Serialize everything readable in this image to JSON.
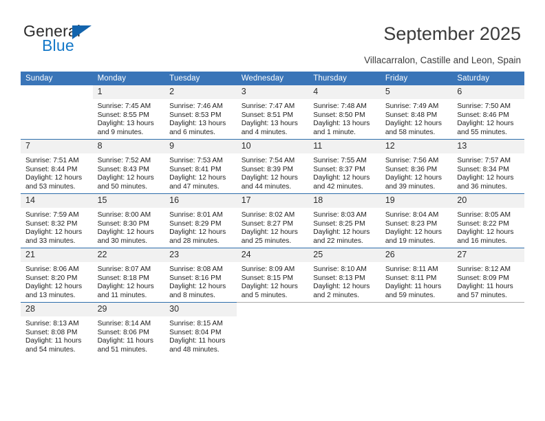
{
  "brand": {
    "name_top": "General",
    "name_bottom": "Blue",
    "triangle_color": "#1263ac",
    "text_color": "#1478c8"
  },
  "header": {
    "title": "September 2025",
    "location": "Villacarralon, Castille and Leon, Spain"
  },
  "theme": {
    "header_row_bg": "#3a75b8",
    "header_row_text": "#ffffff",
    "daynum_bg": "#f1f1f1",
    "row_divider": "#2b6cab",
    "page_bg": "#ffffff"
  },
  "weekdays": [
    "Sunday",
    "Monday",
    "Tuesday",
    "Wednesday",
    "Thursday",
    "Friday",
    "Saturday"
  ],
  "weeks": [
    [
      {
        "day": "",
        "sunrise": "",
        "sunset": "",
        "daylight1": "",
        "daylight2": ""
      },
      {
        "day": "1",
        "sunrise": "Sunrise: 7:45 AM",
        "sunset": "Sunset: 8:55 PM",
        "daylight1": "Daylight: 13 hours",
        "daylight2": "and 9 minutes."
      },
      {
        "day": "2",
        "sunrise": "Sunrise: 7:46 AM",
        "sunset": "Sunset: 8:53 PM",
        "daylight1": "Daylight: 13 hours",
        "daylight2": "and 6 minutes."
      },
      {
        "day": "3",
        "sunrise": "Sunrise: 7:47 AM",
        "sunset": "Sunset: 8:51 PM",
        "daylight1": "Daylight: 13 hours",
        "daylight2": "and 4 minutes."
      },
      {
        "day": "4",
        "sunrise": "Sunrise: 7:48 AM",
        "sunset": "Sunset: 8:50 PM",
        "daylight1": "Daylight: 13 hours",
        "daylight2": "and 1 minute."
      },
      {
        "day": "5",
        "sunrise": "Sunrise: 7:49 AM",
        "sunset": "Sunset: 8:48 PM",
        "daylight1": "Daylight: 12 hours",
        "daylight2": "and 58 minutes."
      },
      {
        "day": "6",
        "sunrise": "Sunrise: 7:50 AM",
        "sunset": "Sunset: 8:46 PM",
        "daylight1": "Daylight: 12 hours",
        "daylight2": "and 55 minutes."
      }
    ],
    [
      {
        "day": "7",
        "sunrise": "Sunrise: 7:51 AM",
        "sunset": "Sunset: 8:44 PM",
        "daylight1": "Daylight: 12 hours",
        "daylight2": "and 53 minutes."
      },
      {
        "day": "8",
        "sunrise": "Sunrise: 7:52 AM",
        "sunset": "Sunset: 8:43 PM",
        "daylight1": "Daylight: 12 hours",
        "daylight2": "and 50 minutes."
      },
      {
        "day": "9",
        "sunrise": "Sunrise: 7:53 AM",
        "sunset": "Sunset: 8:41 PM",
        "daylight1": "Daylight: 12 hours",
        "daylight2": "and 47 minutes."
      },
      {
        "day": "10",
        "sunrise": "Sunrise: 7:54 AM",
        "sunset": "Sunset: 8:39 PM",
        "daylight1": "Daylight: 12 hours",
        "daylight2": "and 44 minutes."
      },
      {
        "day": "11",
        "sunrise": "Sunrise: 7:55 AM",
        "sunset": "Sunset: 8:37 PM",
        "daylight1": "Daylight: 12 hours",
        "daylight2": "and 42 minutes."
      },
      {
        "day": "12",
        "sunrise": "Sunrise: 7:56 AM",
        "sunset": "Sunset: 8:36 PM",
        "daylight1": "Daylight: 12 hours",
        "daylight2": "and 39 minutes."
      },
      {
        "day": "13",
        "sunrise": "Sunrise: 7:57 AM",
        "sunset": "Sunset: 8:34 PM",
        "daylight1": "Daylight: 12 hours",
        "daylight2": "and 36 minutes."
      }
    ],
    [
      {
        "day": "14",
        "sunrise": "Sunrise: 7:59 AM",
        "sunset": "Sunset: 8:32 PM",
        "daylight1": "Daylight: 12 hours",
        "daylight2": "and 33 minutes."
      },
      {
        "day": "15",
        "sunrise": "Sunrise: 8:00 AM",
        "sunset": "Sunset: 8:30 PM",
        "daylight1": "Daylight: 12 hours",
        "daylight2": "and 30 minutes."
      },
      {
        "day": "16",
        "sunrise": "Sunrise: 8:01 AM",
        "sunset": "Sunset: 8:29 PM",
        "daylight1": "Daylight: 12 hours",
        "daylight2": "and 28 minutes."
      },
      {
        "day": "17",
        "sunrise": "Sunrise: 8:02 AM",
        "sunset": "Sunset: 8:27 PM",
        "daylight1": "Daylight: 12 hours",
        "daylight2": "and 25 minutes."
      },
      {
        "day": "18",
        "sunrise": "Sunrise: 8:03 AM",
        "sunset": "Sunset: 8:25 PM",
        "daylight1": "Daylight: 12 hours",
        "daylight2": "and 22 minutes."
      },
      {
        "day": "19",
        "sunrise": "Sunrise: 8:04 AM",
        "sunset": "Sunset: 8:23 PM",
        "daylight1": "Daylight: 12 hours",
        "daylight2": "and 19 minutes."
      },
      {
        "day": "20",
        "sunrise": "Sunrise: 8:05 AM",
        "sunset": "Sunset: 8:22 PM",
        "daylight1": "Daylight: 12 hours",
        "daylight2": "and 16 minutes."
      }
    ],
    [
      {
        "day": "21",
        "sunrise": "Sunrise: 8:06 AM",
        "sunset": "Sunset: 8:20 PM",
        "daylight1": "Daylight: 12 hours",
        "daylight2": "and 13 minutes."
      },
      {
        "day": "22",
        "sunrise": "Sunrise: 8:07 AM",
        "sunset": "Sunset: 8:18 PM",
        "daylight1": "Daylight: 12 hours",
        "daylight2": "and 11 minutes."
      },
      {
        "day": "23",
        "sunrise": "Sunrise: 8:08 AM",
        "sunset": "Sunset: 8:16 PM",
        "daylight1": "Daylight: 12 hours",
        "daylight2": "and 8 minutes."
      },
      {
        "day": "24",
        "sunrise": "Sunrise: 8:09 AM",
        "sunset": "Sunset: 8:15 PM",
        "daylight1": "Daylight: 12 hours",
        "daylight2": "and 5 minutes."
      },
      {
        "day": "25",
        "sunrise": "Sunrise: 8:10 AM",
        "sunset": "Sunset: 8:13 PM",
        "daylight1": "Daylight: 12 hours",
        "daylight2": "and 2 minutes."
      },
      {
        "day": "26",
        "sunrise": "Sunrise: 8:11 AM",
        "sunset": "Sunset: 8:11 PM",
        "daylight1": "Daylight: 11 hours",
        "daylight2": "and 59 minutes."
      },
      {
        "day": "27",
        "sunrise": "Sunrise: 8:12 AM",
        "sunset": "Sunset: 8:09 PM",
        "daylight1": "Daylight: 11 hours",
        "daylight2": "and 57 minutes."
      }
    ],
    [
      {
        "day": "28",
        "sunrise": "Sunrise: 8:13 AM",
        "sunset": "Sunset: 8:08 PM",
        "daylight1": "Daylight: 11 hours",
        "daylight2": "and 54 minutes."
      },
      {
        "day": "29",
        "sunrise": "Sunrise: 8:14 AM",
        "sunset": "Sunset: 8:06 PM",
        "daylight1": "Daylight: 11 hours",
        "daylight2": "and 51 minutes."
      },
      {
        "day": "30",
        "sunrise": "Sunrise: 8:15 AM",
        "sunset": "Sunset: 8:04 PM",
        "daylight1": "Daylight: 11 hours",
        "daylight2": "and 48 minutes."
      },
      {
        "day": "",
        "sunrise": "",
        "sunset": "",
        "daylight1": "",
        "daylight2": ""
      },
      {
        "day": "",
        "sunrise": "",
        "sunset": "",
        "daylight1": "",
        "daylight2": ""
      },
      {
        "day": "",
        "sunrise": "",
        "sunset": "",
        "daylight1": "",
        "daylight2": ""
      },
      {
        "day": "",
        "sunrise": "",
        "sunset": "",
        "daylight1": "",
        "daylight2": ""
      }
    ]
  ]
}
